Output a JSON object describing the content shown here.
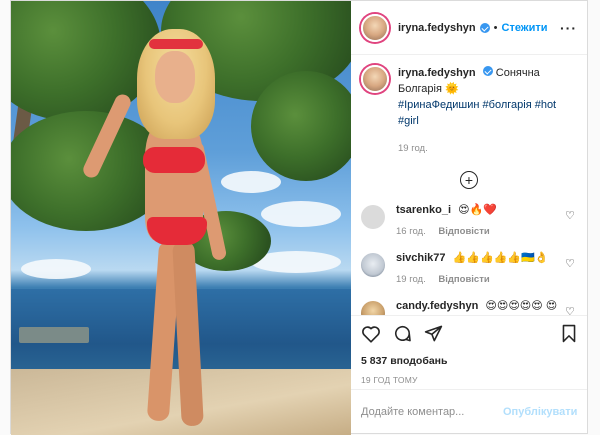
{
  "post": {
    "author": "iryna.fedyshyn",
    "follow_label": "Стежити",
    "caption_text": "Сонячна Болгарія 🌞",
    "hashtags": "#ІринаФедишин #болгарія #hot #girl",
    "caption_time": "19 год."
  },
  "comments": [
    {
      "user": "tsarenko_i",
      "text": "😍🔥❤️",
      "time": "16 год.",
      "reply_label": "Відповісти"
    },
    {
      "user": "sivchik77",
      "text": "👍👍👍👍👍🇺🇦👌",
      "time": "19 год.",
      "reply_label": "Відповісти"
    },
    {
      "user": "candy.fedyshyn",
      "text": "😍😍😍😍😍 😍😍",
      "time": "",
      "reply_label": ""
    }
  ],
  "stats": {
    "likes": "5 837 вподобань",
    "posted_ago": "19 ГОД ТОМУ"
  },
  "add_comment": {
    "placeholder": "Додайте коментар...",
    "publish_label": "Опублікувати"
  },
  "icons": {
    "more": "more-icon",
    "heart": "heart-icon",
    "comment": "comment-icon",
    "share": "share-icon",
    "bookmark": "bookmark-icon",
    "plus": "plus-circle-icon"
  },
  "colors": {
    "link": "#0095f6",
    "hashtag": "#00376b",
    "publish_disabled": "#b2dffc",
    "border": "#dbdbdb"
  }
}
